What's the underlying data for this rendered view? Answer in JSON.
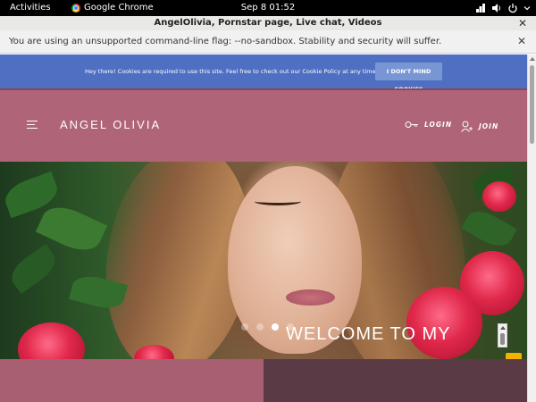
{
  "system_bar": {
    "activities": "Activities",
    "app_name": "Google Chrome",
    "clock": "Sep 8  01:52"
  },
  "window": {
    "title": "AngelOlivia, Pornstar page, Live chat, Videos"
  },
  "infobar": {
    "message": "You are using an unsupported command-line flag: --no-sandbox. Stability and security will suffer."
  },
  "cookie_banner": {
    "text": "Hey there! Cookies are required to use this site. Feel free to check out our Cookie Policy at any time.",
    "button_label": "I DON'T MIND COOKIES",
    "background": "#4e6fc2"
  },
  "site_header": {
    "brand": "ANGEL OLIVIA",
    "login_label": "LOGIN",
    "join_label": "JOIN",
    "background": "#b06477"
  },
  "hero": {
    "slide_count": 4,
    "active_slide": 3
  },
  "welcome": {
    "heading": "WELCOME TO MY"
  },
  "icons": [
    "menu-icon",
    "key-icon",
    "add-user-icon",
    "network-icon",
    "volume-icon",
    "power-icon",
    "close-icon",
    "chrome-icon",
    "gift-icon"
  ]
}
